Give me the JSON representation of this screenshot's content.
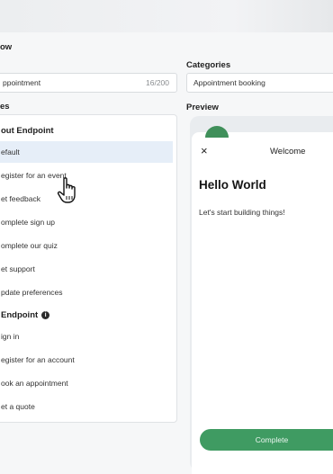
{
  "header": {
    "title_fragment": "ow"
  },
  "name_field": {
    "value": "ppointment",
    "counter": "16/200"
  },
  "categories": {
    "label": "Categories",
    "value": "Appointment booking"
  },
  "templates_label": "es",
  "groups": [
    {
      "title": "out Endpoint",
      "items": [
        {
          "label": "efault",
          "selected": true
        },
        {
          "label": "egister for an event",
          "selected": false
        },
        {
          "label": "et feedback",
          "selected": false
        },
        {
          "label": "omplete sign up",
          "selected": false
        },
        {
          "label": "omplete our quiz",
          "selected": false
        },
        {
          "label": "et support",
          "selected": false
        },
        {
          "label": "pdate preferences",
          "selected": false
        }
      ]
    },
    {
      "title": "Endpoint",
      "info_icon": "info-icon",
      "items": [
        {
          "label": "ign in"
        },
        {
          "label": "egister for an account"
        },
        {
          "label": "ook an appointment"
        },
        {
          "label": "et a quote"
        }
      ]
    }
  ],
  "preview": {
    "label": "Preview",
    "close_glyph": "×",
    "header_title": "Welcome",
    "heading": "Hello World",
    "body": "Let's start building things!",
    "button": "Complete"
  },
  "colors": {
    "accent_green": "#3f9b62",
    "selected_row": "#e6eef8"
  }
}
